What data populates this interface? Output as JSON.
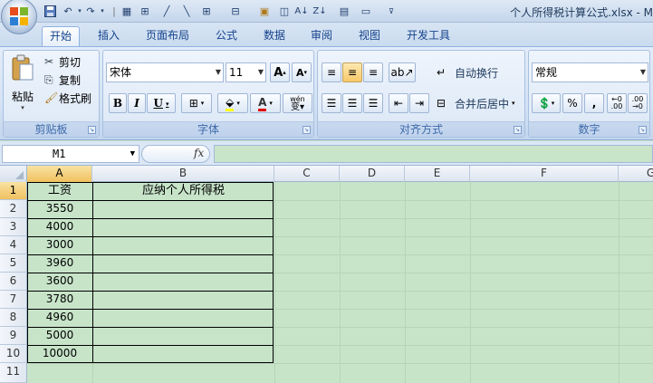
{
  "window": {
    "title": "个人所得税计算公式.xlsx - M"
  },
  "quick_access": [
    "save-icon",
    "undo-icon",
    "redo-icon",
    "table-icon",
    "border-icon",
    "line-icon",
    "line2-icon",
    "grid-icon",
    "paste-icon",
    "sort-asc-icon",
    "sort-desc-icon",
    "print-preview-icon",
    "format-icon",
    "dropdown-icon"
  ],
  "tabs": [
    "开始",
    "插入",
    "页面布局",
    "公式",
    "数据",
    "审阅",
    "视图",
    "开发工具"
  ],
  "active_tab": "开始",
  "clipboard": {
    "paste": "粘贴",
    "cut": "剪切",
    "copy": "复制",
    "format_painter": "格式刷",
    "label": "剪贴板"
  },
  "font": {
    "name": "宋体",
    "size": "11",
    "bold": "B",
    "italic": "I",
    "underline": "U",
    "label": "字体",
    "grow": "A",
    "shrink": "A",
    "phonetic": "wén"
  },
  "alignment": {
    "wrap": "自动换行",
    "merge": "合并后居中",
    "label": "对齐方式"
  },
  "number": {
    "format": "常规",
    "percent": "%",
    "comma": ",",
    "label": "数字",
    "inc_decimal": ".00",
    "dec_decimal": ".00"
  },
  "formula_bar": {
    "name_box": "M1",
    "fx": "fx",
    "value": ""
  },
  "columns": [
    "A",
    "B",
    "C",
    "D",
    "E",
    "F",
    "G"
  ],
  "rows": [
    "1",
    "2",
    "3",
    "4",
    "5",
    "6",
    "7",
    "8",
    "9",
    "10",
    "11"
  ],
  "sheet": {
    "header_a": "工资",
    "header_b": "应纳个人所得税",
    "salaries": [
      "3550",
      "4000",
      "3000",
      "3960",
      "3600",
      "3780",
      "4960",
      "5000",
      "10000"
    ]
  },
  "colors": {
    "grid_bg": "#c7e4c9",
    "ribbon": "#dbe7f5",
    "accent": "#15428b",
    "selected_header": "#f1c15f"
  }
}
